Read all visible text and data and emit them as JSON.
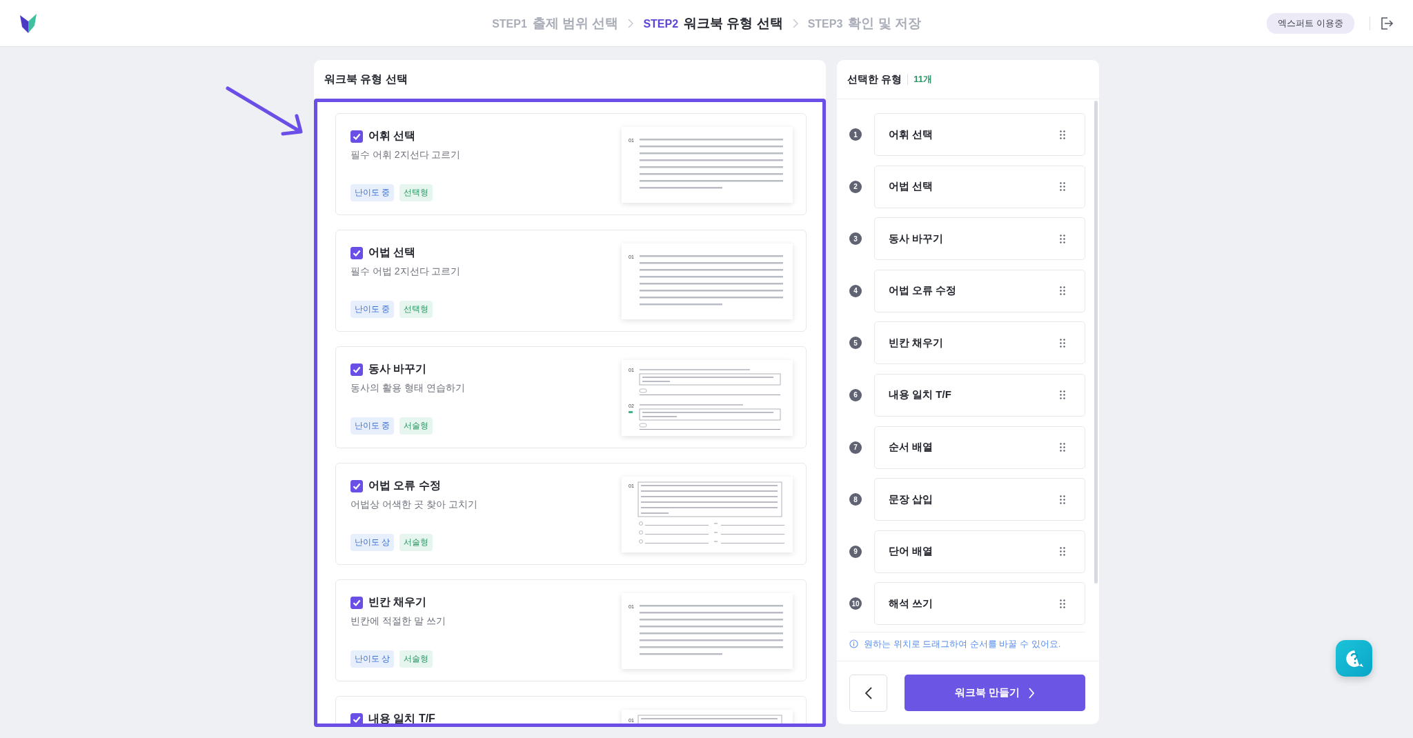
{
  "header": {
    "steps": [
      {
        "step": "STEP1",
        "label": "출제 범위 선택",
        "selected": false
      },
      {
        "step": "STEP2",
        "label": "워크북 유형 선택",
        "selected": true
      },
      {
        "step": "STEP3",
        "label": "확인 및 저장",
        "selected": false
      }
    ],
    "plan_badge": "엑스퍼트 이용중"
  },
  "type_panel": {
    "title": "워크북 유형 선택",
    "cards": [
      {
        "title": "어휘 선택",
        "checked": true,
        "subtitle": "필수 어휘 2지선다 고르기",
        "tags": [
          {
            "text": "난이도 중",
            "kind": "level"
          },
          {
            "text": "선택형",
            "kind": "format"
          }
        ],
        "preview": {
          "kind": "paragraph",
          "numbers": [
            "01"
          ]
        }
      },
      {
        "title": "어법 선택",
        "checked": true,
        "subtitle": "필수 어법 2지선다 고르기",
        "tags": [
          {
            "text": "난이도 중",
            "kind": "level"
          },
          {
            "text": "선택형",
            "kind": "format"
          }
        ],
        "preview": {
          "kind": "paragraph",
          "numbers": [
            "01"
          ]
        }
      },
      {
        "title": "동사 바꾸기",
        "checked": true,
        "subtitle": "동사의 활용 형태 연습하기",
        "tags": [
          {
            "text": "난이도 중",
            "kind": "level"
          },
          {
            "text": "서술형",
            "kind": "format"
          }
        ],
        "preview": {
          "kind": "sections",
          "numbers": [
            "01",
            "02"
          ]
        }
      },
      {
        "title": "어법 오류 수정",
        "checked": true,
        "subtitle": "어법상 어색한 곳 찾아 고치기",
        "tags": [
          {
            "text": "난이도 상",
            "kind": "level"
          },
          {
            "text": "서술형",
            "kind": "format"
          }
        ],
        "preview": {
          "kind": "correction",
          "numbers": [
            "01"
          ]
        }
      },
      {
        "title": "빈칸 채우기",
        "checked": true,
        "subtitle": "빈칸에 적절한 말 쓰기",
        "tags": [
          {
            "text": "난이도 상",
            "kind": "level"
          },
          {
            "text": "서술형",
            "kind": "format"
          }
        ],
        "preview": {
          "kind": "paragraph",
          "numbers": [
            "01"
          ]
        }
      },
      {
        "title": "내용 일치 T/F",
        "checked": true,
        "preview": {
          "kind": "boxed",
          "numbers": [
            "01"
          ]
        }
      }
    ]
  },
  "selected_panel": {
    "title": "선택한 유형",
    "count": "11개",
    "items": [
      {
        "number": "1",
        "label": "어휘 선택"
      },
      {
        "number": "2",
        "label": "어법 선택"
      },
      {
        "number": "3",
        "label": "동사 바꾸기"
      },
      {
        "number": "4",
        "label": "어법 오류 수정"
      },
      {
        "number": "5",
        "label": "빈칸 채우기"
      },
      {
        "number": "6",
        "label": "내용 일치 T/F"
      },
      {
        "number": "7",
        "label": "순서 배열"
      },
      {
        "number": "8",
        "label": "문장 삽입"
      },
      {
        "number": "9",
        "label": "단어 배열"
      },
      {
        "number": "10",
        "label": "해석 쓰기"
      }
    ],
    "hint": "원하는 위치로 드래그하여 순서를 바꿀 수 있어요.",
    "next_button": "워크북 만들기"
  }
}
